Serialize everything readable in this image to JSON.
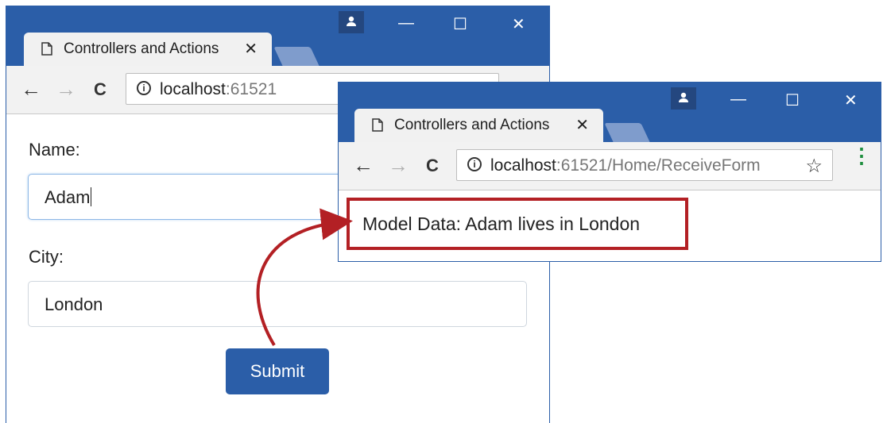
{
  "window_back": {
    "tab_title": "Controllers and Actions",
    "url_host": "localhost",
    "url_rest": ":61521",
    "form": {
      "name_label": "Name:",
      "name_value": "Adam",
      "city_label": "City:",
      "city_value": "London",
      "submit_label": "Submit"
    }
  },
  "window_front": {
    "tab_title": "Controllers and Actions",
    "url_host": "localhost",
    "url_rest": ":61521/Home/ReceiveForm",
    "result_text": "Model Data: Adam lives in London"
  },
  "glyphs": {
    "back": "←",
    "forward": "→",
    "reload": "C",
    "close_tab": "✕",
    "minimize": "—",
    "maximize": "☐",
    "close_window": "✕",
    "star": "☆",
    "menu": "⋮",
    "info": "i"
  },
  "colors": {
    "titlebar": "#2b5ea8",
    "submit": "#2b5ea8",
    "highlight": "#b32024",
    "menu_dots": "#1e8e3e"
  }
}
